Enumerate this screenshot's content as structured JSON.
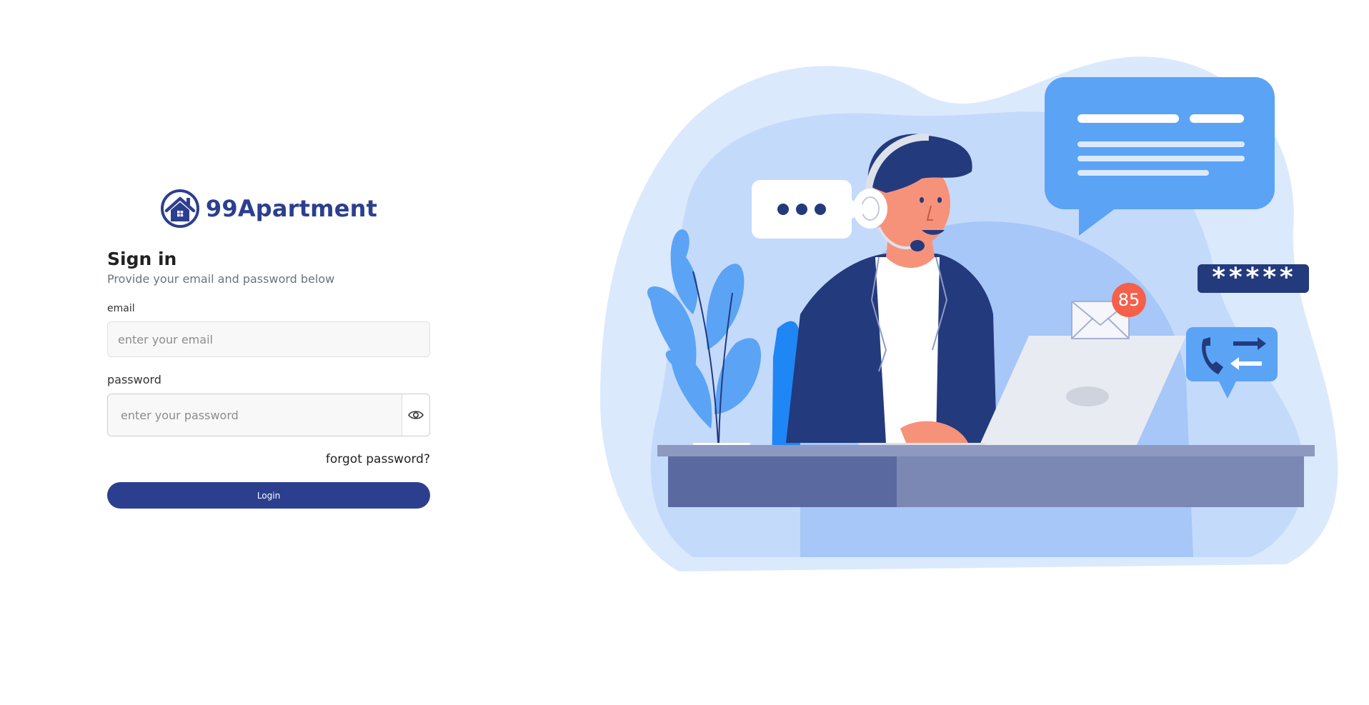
{
  "brand": {
    "name": "99Apartment",
    "logo_icon": "house-in-circle-icon",
    "color": "#2c3f8f"
  },
  "signin": {
    "title": "Sign in",
    "subtitle": "Provide your email and password below",
    "email": {
      "label": "email",
      "placeholder": "enter your email",
      "value": ""
    },
    "password": {
      "label": "password",
      "placeholder": "enter your password",
      "value": "",
      "toggle_icon": "eye-icon"
    },
    "forgot_label": "forgot password?",
    "login_label": "Login"
  },
  "illustration": {
    "notification_count": "85",
    "password_mask": "*****",
    "icons": [
      "chat-bubble-icon",
      "mail-icon",
      "phone-transfer-icon",
      "plant-icon",
      "laptop-icon",
      "headset-icon"
    ],
    "colors": {
      "light_blob": "#dbe9fd",
      "mid_blob": "#bcd6fb",
      "accent_blue": "#5ba3f5",
      "navy": "#233a7d",
      "desk": "#7a88b3"
    }
  }
}
